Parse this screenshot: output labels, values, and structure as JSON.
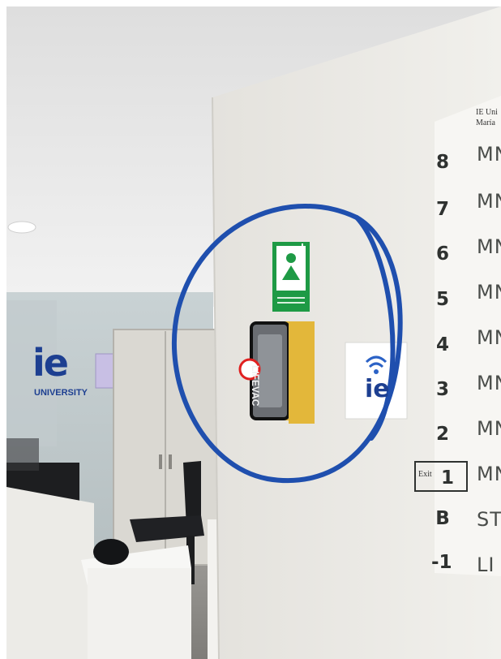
{
  "board_header": [
    "IE Uni",
    "María"
  ],
  "floors": [
    {
      "num": "8",
      "text": "MN"
    },
    {
      "num": "7",
      "text": "MN"
    },
    {
      "num": "6",
      "text": "MN"
    },
    {
      "num": "5",
      "text": "MN"
    },
    {
      "num": "4",
      "text": "MN"
    },
    {
      "num": "3",
      "text": "MN"
    },
    {
      "num": "2",
      "text": "MN"
    },
    {
      "num": "1",
      "text": "MN"
    },
    {
      "num": "B",
      "text": "ST"
    },
    {
      "num": "-1",
      "text": "LI"
    }
  ],
  "exit_label": "Exit",
  "glass_logo": {
    "mark": "ie",
    "text": "UNIVERSITY"
  },
  "wall_logo_mark": "ie",
  "kit_brand": "LIFEVAC",
  "colors": {
    "highlight_circle": "#1f4fae",
    "safety_green": "#1e9a45",
    "kit_yellow": "#e3b73a"
  }
}
